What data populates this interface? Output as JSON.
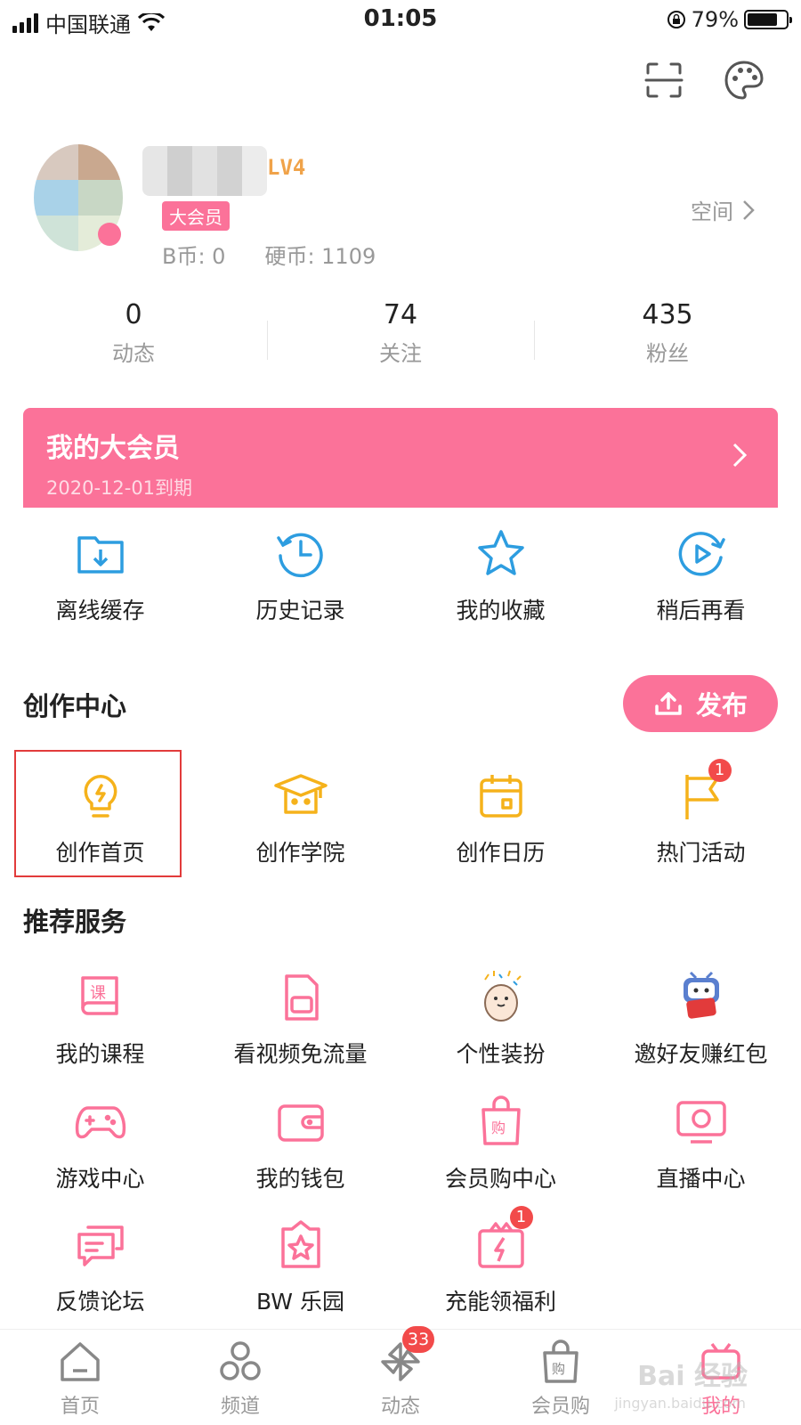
{
  "status": {
    "carrier": "中国联通",
    "time": "01:05",
    "battery": "79%",
    "battery_level": 0.79
  },
  "profile": {
    "level": "LV4",
    "vip_badge": "大会员",
    "bcoin": "B币: 0",
    "coins": "硬币: 1109",
    "space": "空间"
  },
  "stats": [
    {
      "num": "0",
      "label": "动态"
    },
    {
      "num": "74",
      "label": "关注"
    },
    {
      "num": "435",
      "label": "粉丝"
    }
  ],
  "vip_banner": {
    "title": "我的大会员",
    "expiry": "2020-12-01到期"
  },
  "quick": [
    {
      "label": "离线缓存",
      "icon": "download-folder-icon"
    },
    {
      "label": "历史记录",
      "icon": "history-clock-icon"
    },
    {
      "label": "我的收藏",
      "icon": "star-icon"
    },
    {
      "label": "稍后再看",
      "icon": "watch-later-icon"
    }
  ],
  "creation": {
    "title": "创作中心",
    "publish": "发布",
    "items": [
      {
        "label": "创作首页",
        "icon": "lightbulb-icon"
      },
      {
        "label": "创作学院",
        "icon": "graduation-cap-icon"
      },
      {
        "label": "创作日历",
        "icon": "calendar-icon"
      },
      {
        "label": "热门活动",
        "icon": "flag-icon",
        "badge": "1"
      }
    ]
  },
  "services": {
    "title": "推荐服务",
    "items": [
      {
        "label": "我的课程",
        "icon": "course-book-icon"
      },
      {
        "label": "看视频免流量",
        "icon": "sim-card-icon"
      },
      {
        "label": "个性装扮",
        "icon": "mascot-icon"
      },
      {
        "label": "邀好友赚红包",
        "icon": "tv-mascot-icon"
      },
      {
        "label": "游戏中心",
        "icon": "gamepad-icon"
      },
      {
        "label": "我的钱包",
        "icon": "wallet-icon"
      },
      {
        "label": "会员购中心",
        "icon": "shopping-bag-icon"
      },
      {
        "label": "直播中心",
        "icon": "live-tv-icon"
      },
      {
        "label": "反馈论坛",
        "icon": "chat-bubbles-icon"
      },
      {
        "label": "BW 乐园",
        "icon": "badge-star-icon"
      },
      {
        "label": "充能领福利",
        "icon": "gift-bolt-icon",
        "badge": "1"
      }
    ]
  },
  "tabs": [
    {
      "label": "首页",
      "icon": "home-icon"
    },
    {
      "label": "频道",
      "icon": "channel-icon"
    },
    {
      "label": "动态",
      "icon": "pinwheel-icon",
      "badge": "33"
    },
    {
      "label": "会员购",
      "icon": "shopping-bag-icon"
    },
    {
      "label": "我的",
      "icon": "tv-icon",
      "active": true
    }
  ],
  "watermark": {
    "text": "Bai 经验",
    "sub": "jingyan.baidu.com"
  },
  "colors": {
    "accent": "#fb7299",
    "creation": "#f5b21b",
    "blue": "#2d9de0",
    "badge": "#f24a4a"
  }
}
